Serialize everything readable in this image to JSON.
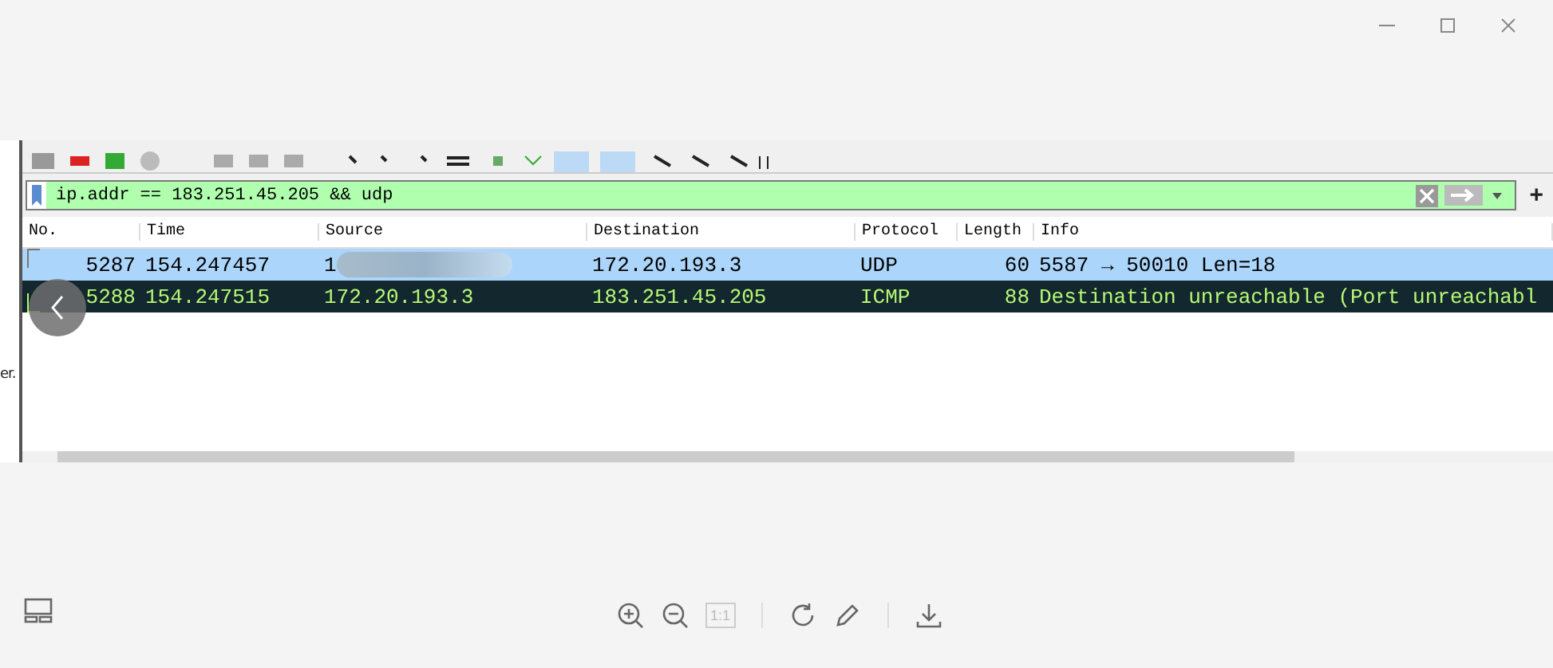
{
  "background_page": {
    "text": "er."
  },
  "capture": {
    "filter": {
      "value": "ip.addr == 183.251.45.205 && udp",
      "plus": "+"
    },
    "columns": [
      "No.",
      "Time",
      "Source",
      "Destination",
      "Protocol",
      "Length",
      "Info"
    ],
    "rows": [
      {
        "selected": true,
        "cells": [
          "5287",
          "154.247457",
          "1",
          "172.20.193.3",
          "UDP",
          "60",
          "5587 → 50010 Len=18"
        ],
        "blurred_source": true
      },
      {
        "selected": false,
        "color": "#12272e",
        "cells": [
          "5288",
          "154.247515",
          "172.20.193.3",
          "183.251.45.205",
          "ICMP",
          "88",
          "Destination unreachable (Port unreachabl"
        ],
        "blurred_source": false
      }
    ]
  },
  "viewer_toolbar": {
    "one_to_one": {
      "label": "1:1",
      "disabled": true
    }
  }
}
